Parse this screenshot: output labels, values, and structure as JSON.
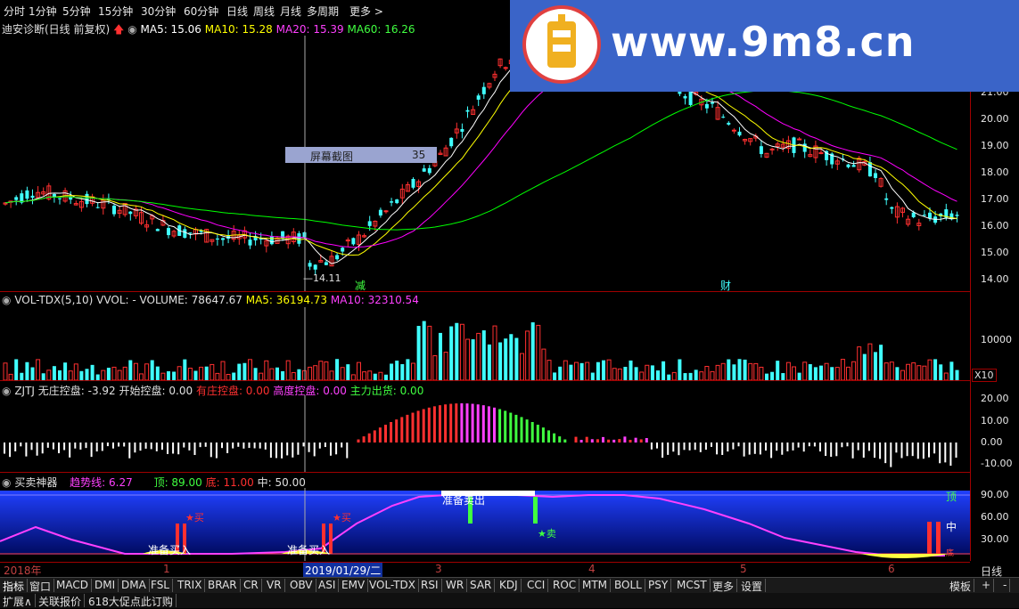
{
  "toolbar": {
    "items": [
      "分时",
      "1分钟",
      "5分钟",
      "15分钟",
      "30分钟",
      "60分钟",
      "日线",
      "周线",
      "月线",
      "多周期",
      "更多 >"
    ]
  },
  "price_panel": {
    "title": "迪安诊断(日线 前复权)",
    "ma5": "MA5: 15.06",
    "ma10": "MA10: 15.28",
    "ma20": "MA20: 15.39",
    "ma60": "MA60: 16.26",
    "low_label": "14.11",
    "marker_jian": "减",
    "marker_cai": "财",
    "y_ticks": [
      "21.00",
      "20.00",
      "19.00",
      "18.00",
      "17.00",
      "16.00",
      "15.00",
      "14.00"
    ],
    "colors": {
      "ma5": "#ffffff",
      "ma10": "#ffff00",
      "ma20": "#ff00ff",
      "ma60": "#00ff00"
    }
  },
  "screenshot_overlay": {
    "label": "屏幕截图",
    "value": "35"
  },
  "volume_panel": {
    "title": "VOL-TDX(5,10)",
    "vol": "VVOL: -",
    "volume": "VOLUME: 78647.67",
    "ma5": "MA5: 36194.73",
    "ma10": "MA10: 32310.54",
    "y_tick": "10000",
    "unit": "X10"
  },
  "zjtj_panel": {
    "title": "ZJTJ",
    "wuzhuang": "无庄控盘: -3.92",
    "kaishi": "开始控盘: 0.00",
    "youzhuang": "有庄控盘: 0.00",
    "gaodu": "高度控盘: 0.00",
    "zhuli": "主力出货: 0.00",
    "y_ticks": [
      "20.00",
      "10.00",
      "0.00",
      "-10.00"
    ]
  },
  "mm_panel": {
    "title": "买卖神器",
    "trend": "趋势线: 6.27",
    "top": "顶: 89.00",
    "bottom": "底: 11.00",
    "mid": "中: 50.00",
    "y_ticks": [
      "90.00",
      "60.00",
      "30.00"
    ],
    "labels": {
      "ding": "顶",
      "zhong": "中",
      "di": "底",
      "buy1": "准备买入",
      "buy2": "准备买入",
      "sell_ready": "准备卖出",
      "buy_star1": "★买",
      "buy_star2": "★买",
      "sell_star": "★卖"
    }
  },
  "xaxis": {
    "labels": [
      "2018年",
      "1",
      "2019/01/29/二",
      "3",
      "4",
      "5",
      "6"
    ],
    "period": "日线"
  },
  "tabs": [
    "指标",
    "窗口",
    "MACD",
    "DMI",
    "DMA",
    "FSL",
    "TRIX",
    "BRAR",
    "CR",
    "VR",
    "OBV",
    "ASI",
    "EMV",
    "VOL-TDX",
    "RSI",
    "WR",
    "SAR",
    "KDJ",
    "CCI",
    "ROC",
    "MTM",
    "BOLL",
    "PSY",
    "MCST",
    "更多",
    "设置"
  ],
  "tabs_right": [
    "模板",
    "+",
    "-"
  ],
  "status_bar": [
    "扩展∧",
    "关联报价",
    "618大促点此订购"
  ],
  "watermark": {
    "text": "www.9m8.cn"
  }
}
